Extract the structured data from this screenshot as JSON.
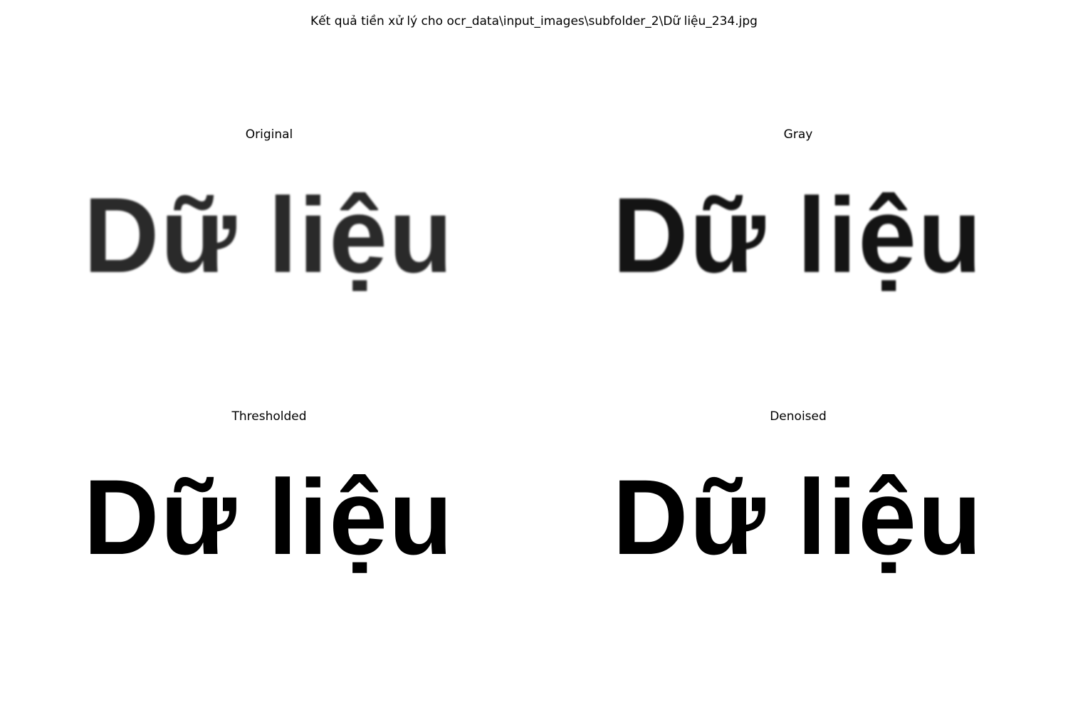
{
  "figure": {
    "title": "Kết quả tiền xử lý cho ocr_data\\input_images\\subfolder_2\\Dữ liệu_234.jpg"
  },
  "panels": [
    {
      "title": "Original",
      "text": "Dữ liệu",
      "style": "blurred-dark-gray"
    },
    {
      "title": "Gray",
      "text": "Dữ liệu",
      "style": "blurred-black"
    },
    {
      "title": "Thresholded",
      "text": "Dữ liệu",
      "style": "binary-black"
    },
    {
      "title": "Denoised",
      "text": "Dữ liệu",
      "style": "binary-black"
    }
  ],
  "colors": {
    "background": "#ffffff",
    "text": "#000000"
  }
}
